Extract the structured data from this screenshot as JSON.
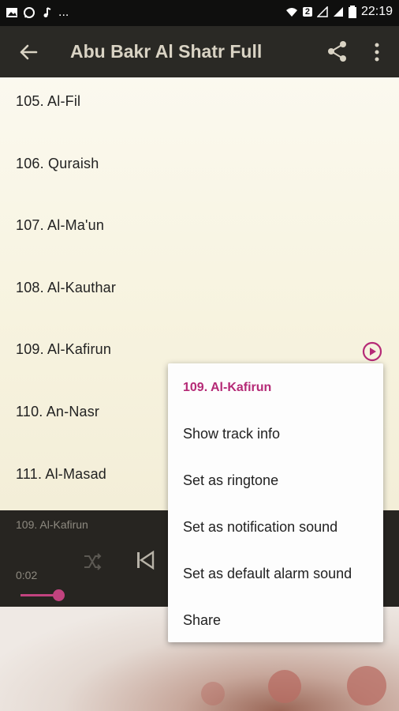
{
  "status_bar": {
    "left_icons": [
      "image-icon",
      "whatsapp-icon",
      "music-note-icon",
      "more-dots"
    ],
    "left_text": "...",
    "right_icons": [
      "wifi-icon",
      "sim-icon",
      "signal-icon",
      "battery-icon"
    ],
    "sim_number": "2",
    "time": "22:19"
  },
  "app_bar": {
    "title": "Abu Bakr Al Shatr Full"
  },
  "list": {
    "items": [
      {
        "label": "105. Al-Fil"
      },
      {
        "label": "106. Quraish"
      },
      {
        "label": "107. Al-Ma'un"
      },
      {
        "label": "108. Al-Kauthar"
      },
      {
        "label": "109. Al-Kafirun"
      },
      {
        "label": "110. An-Nasr"
      },
      {
        "label": "111. Al-Masad"
      }
    ]
  },
  "player": {
    "now_playing": "109. Al-Kafirun",
    "elapsed": "0:02",
    "accent_color": "#c2437f"
  },
  "context_menu": {
    "title": "109. Al-Kafirun",
    "items": [
      {
        "label": "Show track info"
      },
      {
        "label": "Set as ringtone"
      },
      {
        "label": "Set as notification sound"
      },
      {
        "label": "Set as default alarm sound"
      },
      {
        "label": "Share"
      }
    ]
  },
  "colors": {
    "app_bar": "#2a2925",
    "title_text": "#d9d3c4",
    "menu_header": "#b52a76"
  }
}
